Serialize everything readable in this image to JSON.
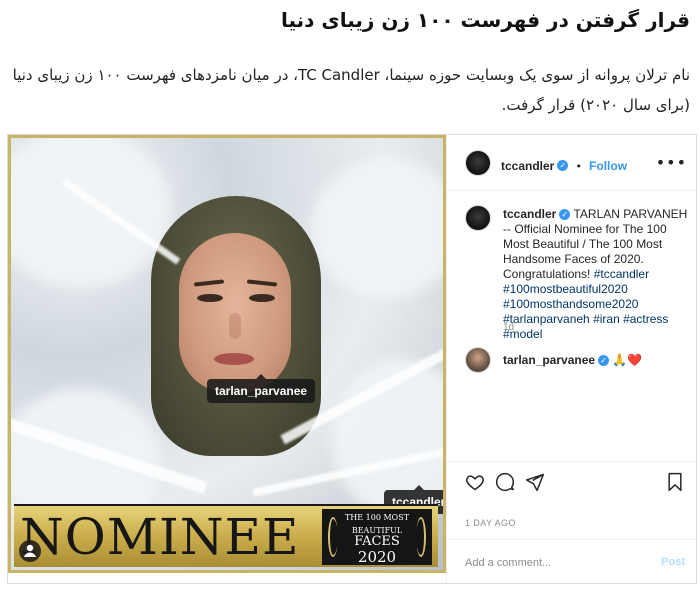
{
  "article": {
    "headline": "قرار گرفتن در فهرست ۱۰۰ زن زیبای دنیا",
    "lead": "نام ترلان پروانه از سوی یک وبسایت حوزه سینما، TC Candler، در میان نامزدهای فهرست ۱۰۰ زن زیبای دنیا (برای سال ۲۰۲۰) قرار گرفت."
  },
  "post": {
    "media": {
      "tag_person": "tarlan_parvanee",
      "tag_account": "tccandler",
      "banner_word": "NOMINEE",
      "badge_line1": "THE 100 MOST",
      "badge_line2": "BEAUTIFUL",
      "badge_line3": "FACES",
      "badge_line4": "2020"
    },
    "header": {
      "username": "tccandler",
      "separator": "•",
      "follow_label": "Follow",
      "more": "•••"
    },
    "caption": {
      "username": "tccandler",
      "text": "TARLAN PARVANEH -- Official Nominee for The 100 Most Beautiful / The 100 Most Handsome Faces of 2020. Congratulations!",
      "hashtags": "#tccandler #100mostbeautiful2020 #100mosthandsome2020 #tarlanparvaneh #iran #actress #model",
      "age": "1d"
    },
    "comment": {
      "username": "tarlan_parvanee",
      "emojis": "🙏❤️"
    },
    "date": "1 DAY AGO",
    "add_comment": {
      "placeholder": "Add a comment...",
      "post_label": "Post"
    },
    "icons": {
      "like": "heart-icon",
      "comment": "comment-icon",
      "share": "share-icon",
      "save": "bookmark-icon",
      "verified": "verified-badge-icon",
      "tag": "person-tag-icon"
    },
    "colors": {
      "link_blue": "#3897f0",
      "hashtag": "#003569",
      "banner_gold": "#c6a948",
      "border": "#dbdbdb"
    }
  }
}
